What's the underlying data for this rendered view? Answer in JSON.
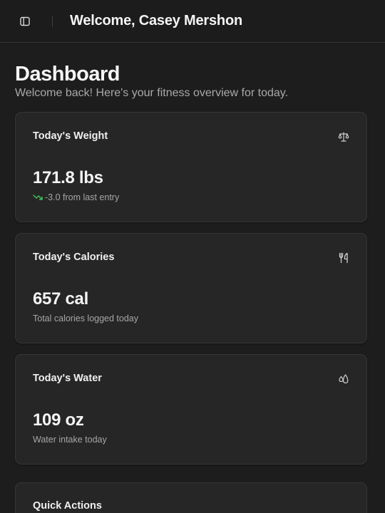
{
  "header": {
    "welcome": "Welcome, Casey Mershon",
    "sidebar_toggle_icon": "panel-left-icon"
  },
  "page": {
    "title": "Dashboard",
    "subtitle": "Welcome back! Here's your fitness overview for today."
  },
  "cards": [
    {
      "title": "Today's Weight",
      "icon": "scale-icon",
      "value": "171.8 lbs",
      "sub": "-3.0 from last entry",
      "trend_icon": "trending-down-icon",
      "trend_color": "#3fbf5a"
    },
    {
      "title": "Today's Calories",
      "icon": "utensils-icon",
      "value": "657 cal",
      "sub": "Total calories logged today"
    },
    {
      "title": "Today's Water",
      "icon": "droplets-icon",
      "value": "109 oz",
      "sub": "Water intake today"
    }
  ],
  "quick_actions": {
    "title": "Quick Actions"
  }
}
